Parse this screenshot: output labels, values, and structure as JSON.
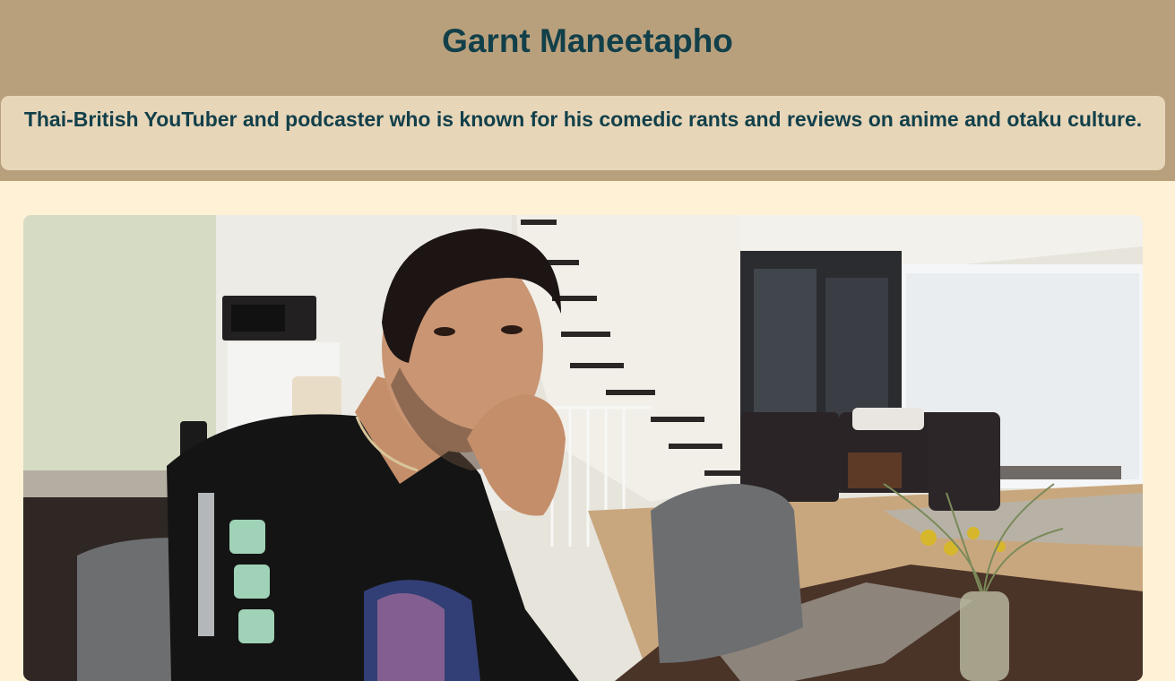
{
  "header": {
    "title": "Garnt Maneetapho",
    "tagline": "Thai-British YouTuber and podcaster who is known for his comedic rants and reviews on anime and otaku culture."
  },
  "photo": {
    "subject": "portrait-photo"
  },
  "colors": {
    "header_bg": "#b9a07c",
    "tagline_bg": "#e8d6b9",
    "page_bg": "#fff1d6",
    "text": "#12404a"
  }
}
